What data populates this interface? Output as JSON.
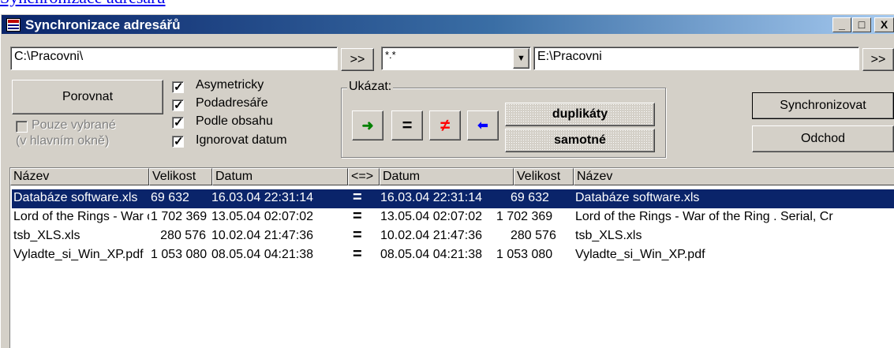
{
  "page_caption": "Synchronizace adresářů",
  "window": {
    "title": "Synchronizace adresářů",
    "caption_buttons": {
      "minimize": "_",
      "maximize": "□",
      "close": "X"
    }
  },
  "paths": {
    "left": "C:\\Pracovni\\",
    "browse_left": ">>",
    "mask": "*.*",
    "dropdown_arrow": "▼",
    "right": "E:\\Pracovni",
    "browse_right": ">>"
  },
  "actions": {
    "compare": "Porovnat",
    "synchronize": "Synchronizovat",
    "exit": "Odchod"
  },
  "only_selected": {
    "label_line1": "Pouze vybrané",
    "label_line2": "(v hlavním okně)",
    "checked": false,
    "enabled": false
  },
  "options": [
    {
      "label": "Asymetricky",
      "checked": true
    },
    {
      "label": "Podadresáře",
      "checked": true
    },
    {
      "label": "Podle obsahu",
      "checked": true
    },
    {
      "label": "Ignorovat datum",
      "checked": true
    }
  ],
  "show_group": {
    "title": "Ukázat:",
    "filters": [
      {
        "icon": "arrow-right",
        "glyph": "➜",
        "color": "#008000"
      },
      {
        "icon": "equals",
        "glyph": "=",
        "color": "#000000"
      },
      {
        "icon": "not-equal",
        "glyph": "≠",
        "color": "#ff0000"
      },
      {
        "icon": "arrow-left",
        "glyph": "⬅",
        "color": "#0000ff"
      }
    ],
    "duplicates": "duplikáty",
    "singles": "samotné"
  },
  "table": {
    "columns": [
      "Název",
      "Velikost",
      "Datum",
      "<=>",
      "Datum",
      "Velikost",
      "Název"
    ],
    "rows": [
      {
        "left_name": "Databáze software.xls",
        "left_size": "69 632",
        "left_date": "16.03.04 22:31:14",
        "cmp": "=",
        "right_date": "16.03.04 22:31:14",
        "right_size": "69 632",
        "right_name": "Databáze software.xls",
        "selected": true
      },
      {
        "left_name": "Lord of the Rings - War of the Ring . Serial, Cr",
        "left_size": "1 702 369",
        "left_date": "13.05.04 02:07:02",
        "cmp": "=",
        "right_date": "13.05.04 02:07:02",
        "right_size": "1 702 369",
        "right_name": "Lord of the Rings - War of the Ring . Serial, Cr",
        "selected": false
      },
      {
        "left_name": "tsb_XLS.xls",
        "left_size": "280 576",
        "left_date": "10.02.04 21:47:36",
        "cmp": "=",
        "right_date": "10.02.04 21:47:36",
        "right_size": "280 576",
        "right_name": "tsb_XLS.xls",
        "selected": false
      },
      {
        "left_name": "Vyladte_si_Win_XP.pdf",
        "left_size": "1 053 080",
        "left_date": "08.05.04 04:21:38",
        "cmp": "=",
        "right_date": "08.05.04 04:21:38",
        "right_size": "1 053 080",
        "right_name": "Vyladte_si_Win_XP.pdf",
        "selected": false
      }
    ]
  },
  "colors": {
    "face": "#d4d0c8",
    "title_active": "#0a246a",
    "selection": "#0a246a"
  }
}
